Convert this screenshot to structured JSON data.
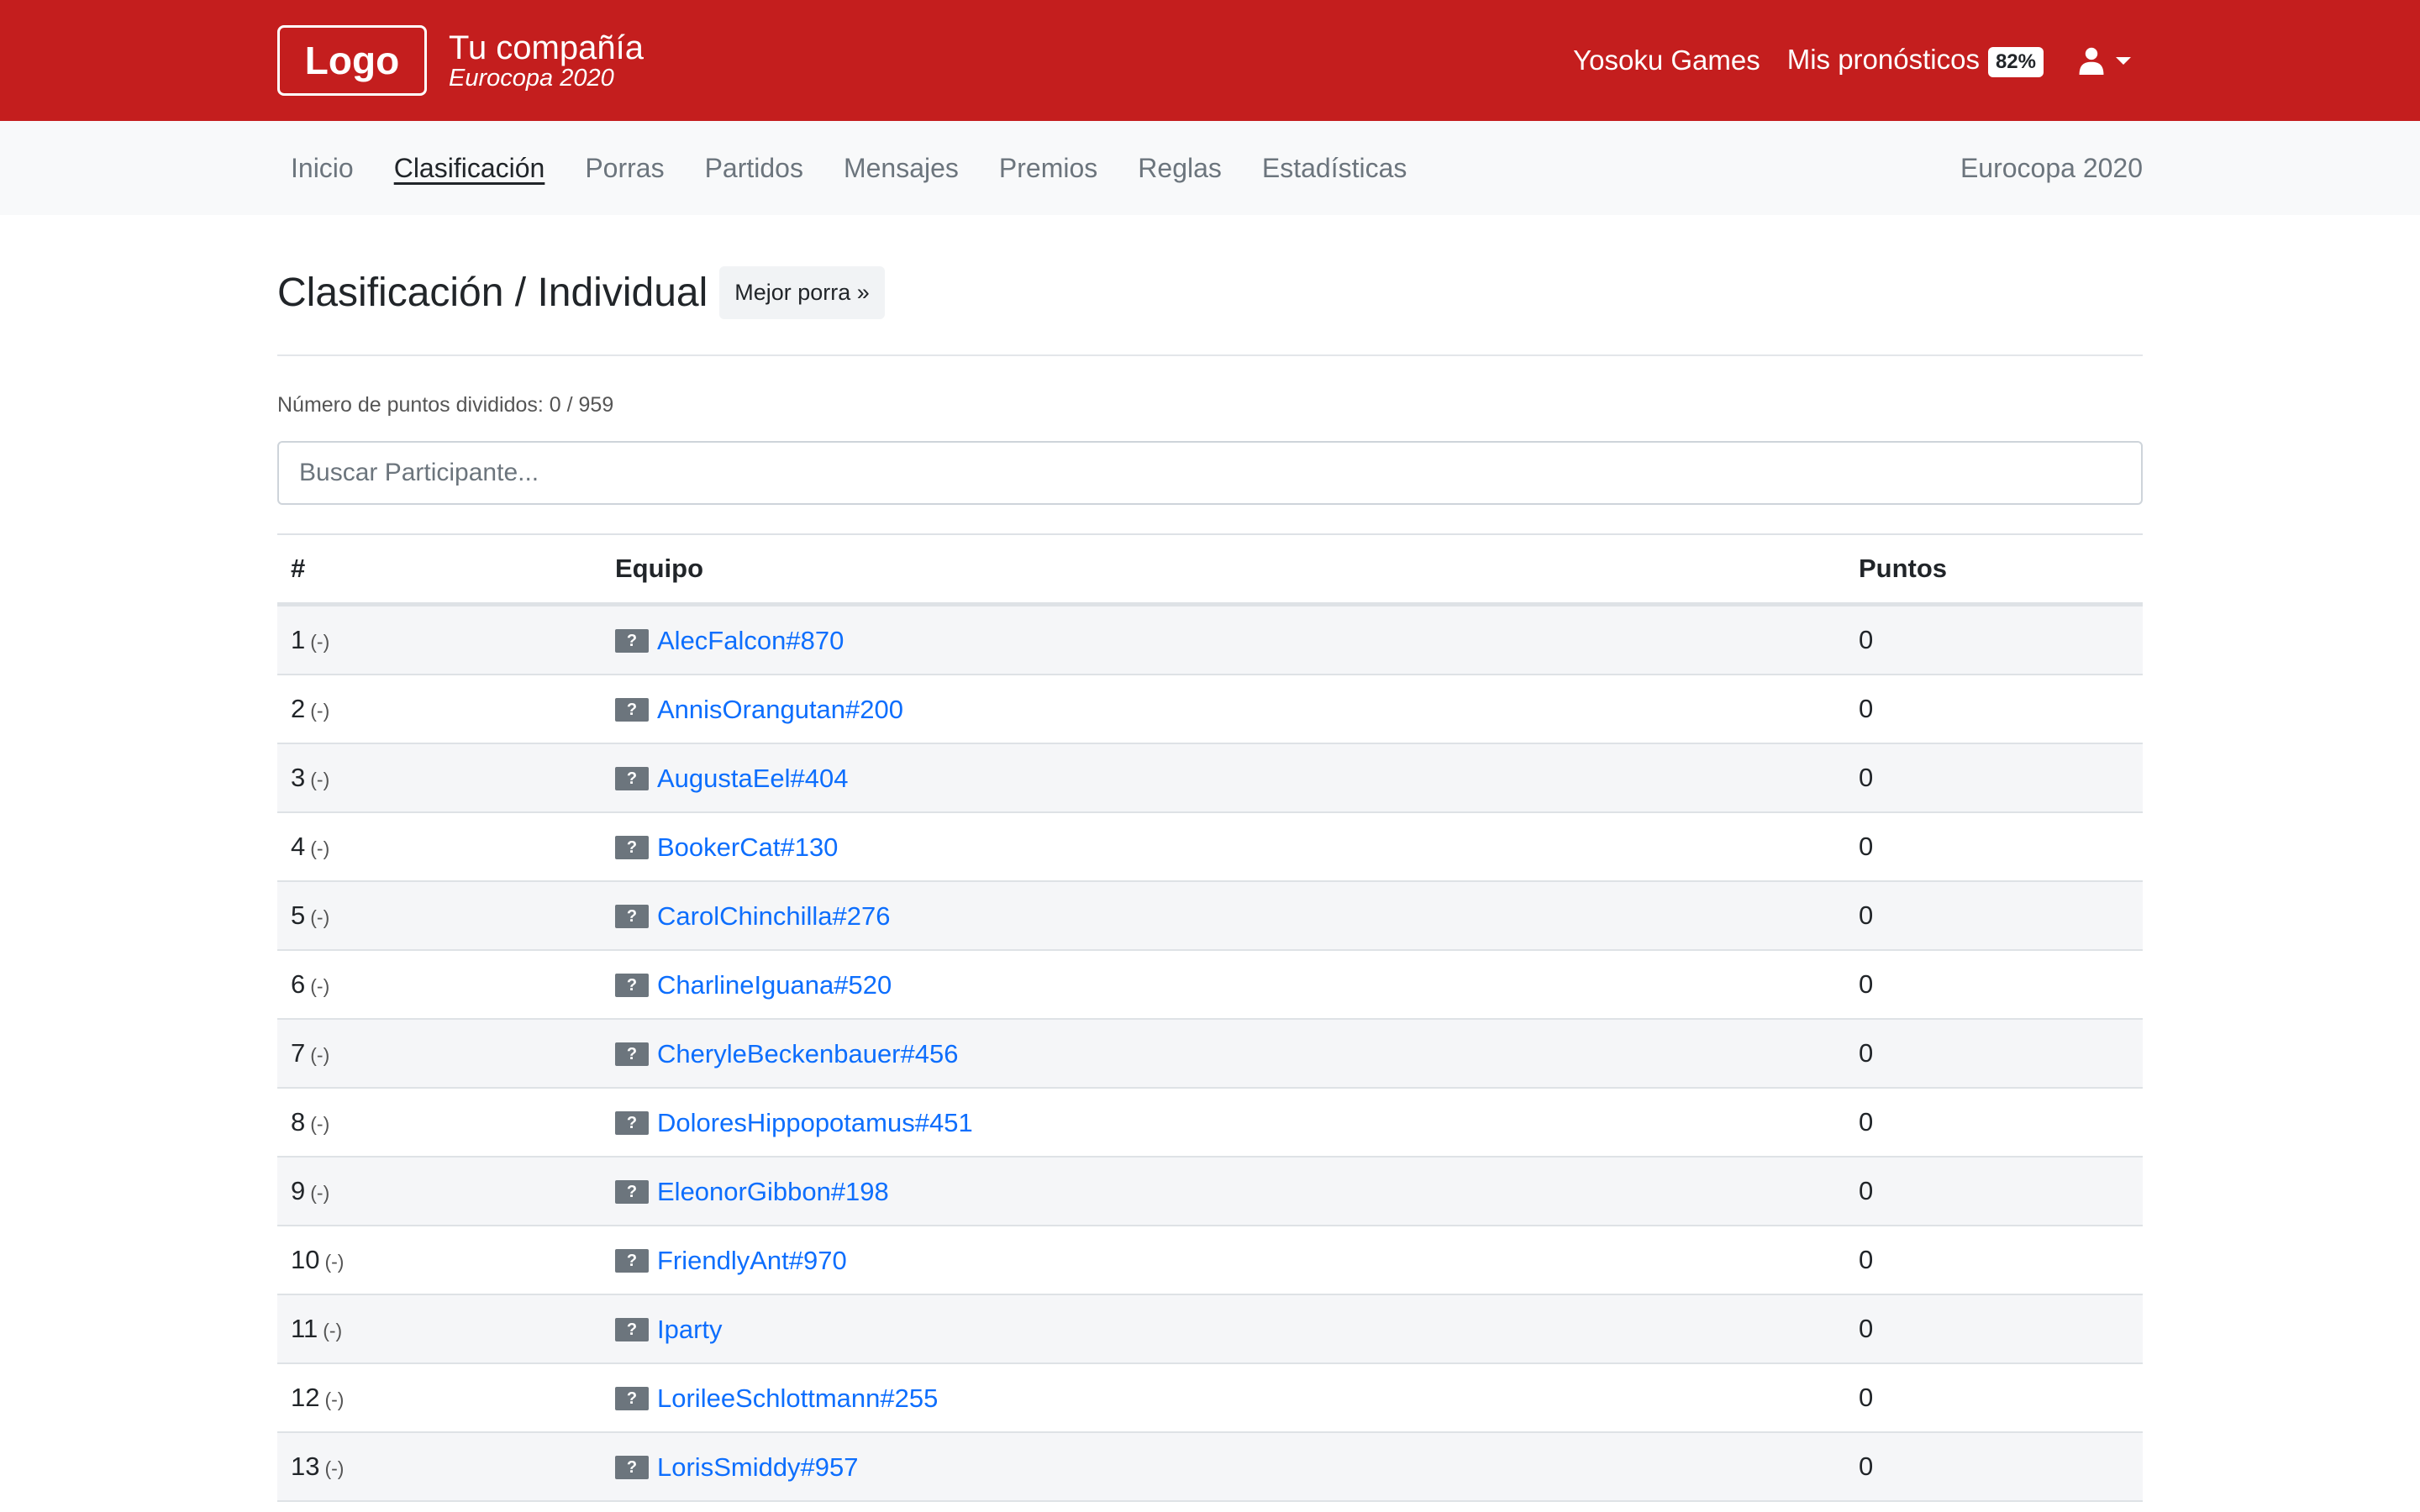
{
  "header": {
    "logo_text": "Logo",
    "company": "Tu compañía",
    "subtitle": "Eurocopa 2020",
    "links": {
      "games": "Yosoku Games",
      "predictions": "Mis pronósticos",
      "predictions_badge": "82%"
    },
    "user_icon": "user-icon",
    "accent_color": "#c41e1e"
  },
  "nav": {
    "items": [
      "Inicio",
      "Clasificación",
      "Porras",
      "Partidos",
      "Mensajes",
      "Premios",
      "Reglas",
      "Estadísticas"
    ],
    "active": "Clasificación",
    "right_label": "Eurocopa 2020"
  },
  "page": {
    "title": "Clasificación / Individual",
    "best_button": "Mejor porra »",
    "points_info": "Número de puntos divididos: 0 / 959",
    "search_placeholder": "Buscar Participante..."
  },
  "table": {
    "headers": [
      "#",
      "Equipo",
      "Puntos"
    ],
    "rows": [
      {
        "rank": "1",
        "delta": "(-)",
        "flag": "?",
        "team": "AlecFalcon#870",
        "points": "0"
      },
      {
        "rank": "2",
        "delta": "(-)",
        "flag": "?",
        "team": "AnnisOrangutan#200",
        "points": "0"
      },
      {
        "rank": "3",
        "delta": "(-)",
        "flag": "?",
        "team": "AugustaEel#404",
        "points": "0"
      },
      {
        "rank": "4",
        "delta": "(-)",
        "flag": "?",
        "team": "BookerCat#130",
        "points": "0"
      },
      {
        "rank": "5",
        "delta": "(-)",
        "flag": "?",
        "team": "CarolChinchilla#276",
        "points": "0"
      },
      {
        "rank": "6",
        "delta": "(-)",
        "flag": "?",
        "team": "CharlineIguana#520",
        "points": "0"
      },
      {
        "rank": "7",
        "delta": "(-)",
        "flag": "?",
        "team": "CheryleBeckenbauer#456",
        "points": "0"
      },
      {
        "rank": "8",
        "delta": "(-)",
        "flag": "?",
        "team": "DoloresHippopotamus#451",
        "points": "0"
      },
      {
        "rank": "9",
        "delta": "(-)",
        "flag": "?",
        "team": "EleonorGibbon#198",
        "points": "0"
      },
      {
        "rank": "10",
        "delta": "(-)",
        "flag": "?",
        "team": "FriendlyAnt#970",
        "points": "0"
      },
      {
        "rank": "11",
        "delta": "(-)",
        "flag": "?",
        "team": "Iparty",
        "points": "0"
      },
      {
        "rank": "12",
        "delta": "(-)",
        "flag": "?",
        "team": "LorileeSchlottmann#255",
        "points": "0"
      },
      {
        "rank": "13",
        "delta": "(-)",
        "flag": "?",
        "team": "LorisSmiddy#957",
        "points": "0"
      }
    ]
  }
}
